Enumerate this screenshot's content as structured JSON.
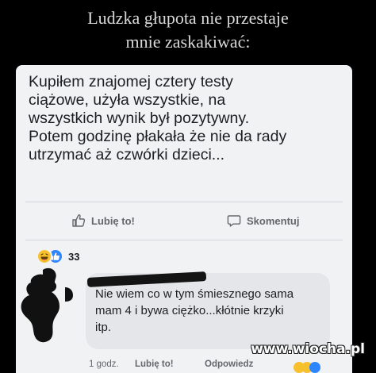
{
  "caption": {
    "line1": "Ludzka głupota nie przestaje",
    "line2": "mnie zaskakiwać:"
  },
  "post": {
    "lines": [
      "Kupiłem znajomej cztery testy",
      "ciążowe, użyła wszystkie, na",
      "wszystkich wynik był pozytywny.",
      "Potem godzinę płakała że nie da rady",
      "utrzymać aż czwórki dzieci..."
    ]
  },
  "actions": {
    "like_label": "Lubię to!",
    "comment_label": "Skomentuj"
  },
  "reactions": {
    "count": "33",
    "types": [
      "haha",
      "like"
    ]
  },
  "comment": {
    "lines": [
      "Nie wiem co w tym śmiesznego sama",
      "mam 4 i bywa ciężko...kłótnie krzyki",
      "itp."
    ],
    "time": "1 godz.",
    "like_label": "Lubię to!",
    "reply_label": "Odpowiedz"
  },
  "watermark": "www.wiocha.pl",
  "colors": {
    "background": "#000000",
    "card": "#f1f2f4",
    "bubble": "#e4e6ea",
    "secondary_text": "#65676b",
    "like_blue": "#2d86ff",
    "haha_yellow": "#f7c12e"
  }
}
